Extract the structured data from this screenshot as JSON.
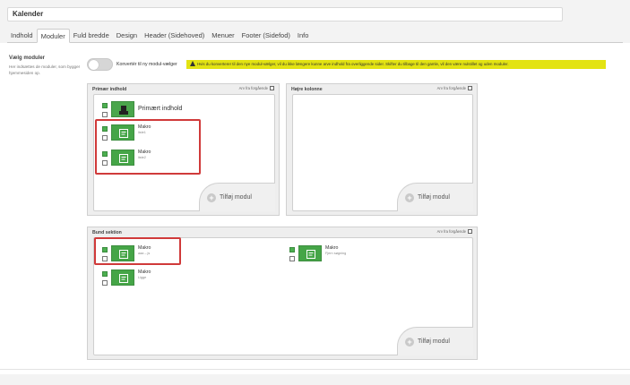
{
  "page": {
    "title": "Kalender"
  },
  "tabs": [
    {
      "label": "Indhold"
    },
    {
      "label": "Moduler",
      "active": true
    },
    {
      "label": "Fuld bredde"
    },
    {
      "label": "Design"
    },
    {
      "label": "Header (Sidehoved)"
    },
    {
      "label": "Menuer"
    },
    {
      "label": "Footer (Sidefod)"
    },
    {
      "label": "Info"
    }
  ],
  "settings": {
    "label": "Vælg moduler",
    "description": "Her indsættes de moduler, som bygger hjemmesiden op.",
    "toggle_label": "Konvertér til ny modul-vælger",
    "toggle_on": false,
    "warning": "Hvis du konverterer til den nye modul-vælger, vil du ikke længere kunne arve indhold fra overliggende sider. Skifter du tilbage til den gamle, vil den være nulstillet og uden moduler.",
    "warning_color": "#e3e312"
  },
  "panels": {
    "primary": {
      "title": "Primær indhold",
      "inherit_label": "Arv fra forgående",
      "primary_module": "Primært indhold",
      "modules": [
        {
          "title": "Makro",
          "subtitle": "liste1"
        },
        {
          "title": "Makro",
          "subtitle": "liste2"
        }
      ],
      "add_label": "Tilføj modul"
    },
    "right": {
      "title": "Højre kolonne",
      "inherit_label": "Arv fra forgående",
      "add_label": "Tilføj modul"
    },
    "bottom": {
      "title": "Bund sektion",
      "inherit_label": "Arv fra forgående",
      "modules": [
        {
          "title": "Makro",
          "subtitle": "aaa – js"
        },
        {
          "title": "Makro",
          "subtitle": "Fjern søgning"
        },
        {
          "title": "Makro",
          "subtitle": "Ligge"
        }
      ],
      "add_label": "Tilføj modul"
    }
  },
  "colors": {
    "module_green": "#45a547",
    "highlight_red": "#d03a3a"
  }
}
